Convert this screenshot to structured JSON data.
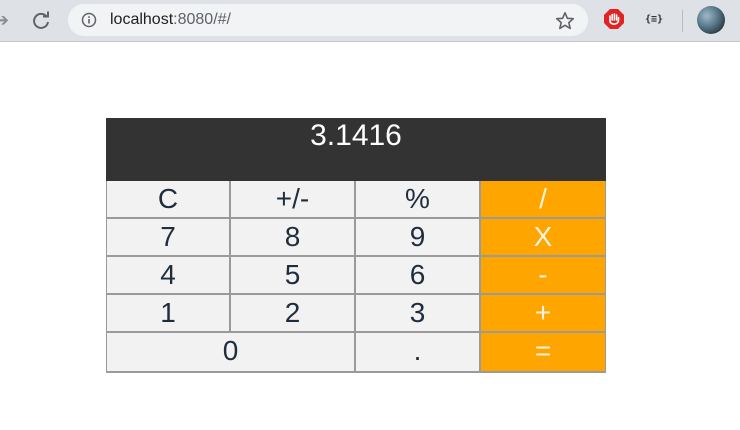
{
  "browser": {
    "url_host": "localhost",
    "url_path": ":8080/#/",
    "json_ext_label": "{≡}"
  },
  "calculator": {
    "display_value": "3.1416",
    "keys": [
      {
        "label": "C",
        "type": "function"
      },
      {
        "label": "+/-",
        "type": "function"
      },
      {
        "label": "%",
        "type": "function"
      },
      {
        "label": "/",
        "type": "operator"
      },
      {
        "label": "7",
        "type": "digit"
      },
      {
        "label": "8",
        "type": "digit"
      },
      {
        "label": "9",
        "type": "digit"
      },
      {
        "label": "X",
        "type": "operator"
      },
      {
        "label": "4",
        "type": "digit"
      },
      {
        "label": "5",
        "type": "digit"
      },
      {
        "label": "6",
        "type": "digit"
      },
      {
        "label": "-",
        "type": "operator"
      },
      {
        "label": "1",
        "type": "digit"
      },
      {
        "label": "2",
        "type": "digit"
      },
      {
        "label": "3",
        "type": "digit"
      },
      {
        "label": "+",
        "type": "operator"
      },
      {
        "label": "0",
        "type": "digit"
      },
      {
        "label": ".",
        "type": "digit"
      },
      {
        "label": "=",
        "type": "operator"
      }
    ]
  },
  "colors": {
    "display_bg": "#333333",
    "operator_bg": "#ffa500",
    "key_bg": "#f2f2f2"
  },
  "icons": [
    "forward-icon",
    "reload-icon",
    "info-icon",
    "star-icon",
    "stop-extension-icon",
    "json-extension-icon",
    "profile-avatar"
  ]
}
